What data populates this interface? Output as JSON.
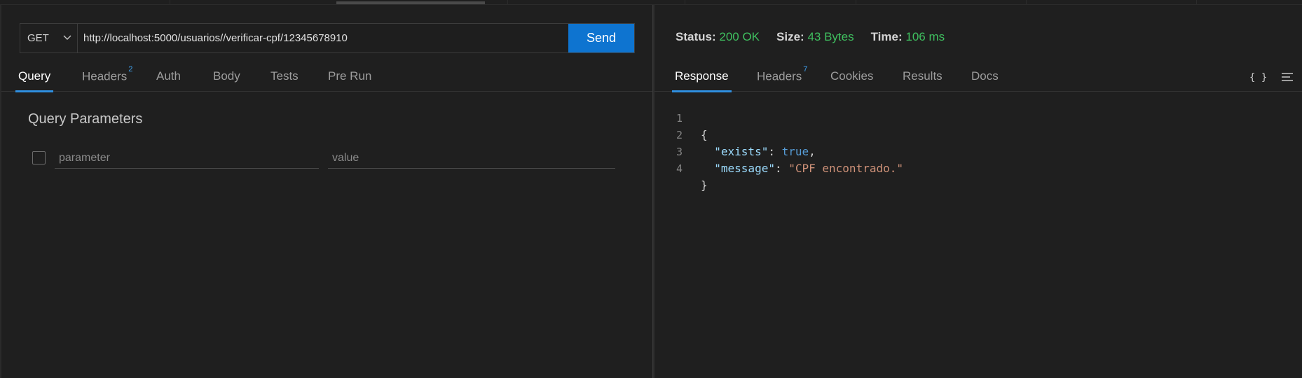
{
  "request": {
    "method": "GET",
    "url": "http://localhost:5000/usuarios//verificar-cpf/12345678910",
    "send_label": "Send",
    "tabs": [
      {
        "label": "Query",
        "badge": ""
      },
      {
        "label": "Headers",
        "badge": "2"
      },
      {
        "label": "Auth",
        "badge": ""
      },
      {
        "label": "Body",
        "badge": ""
      },
      {
        "label": "Tests",
        "badge": ""
      },
      {
        "label": "Pre Run",
        "badge": ""
      }
    ],
    "active_tab": "Query",
    "query_title": "Query Parameters",
    "param_placeholder": "parameter",
    "value_placeholder": "value"
  },
  "response": {
    "status_label": "Status:",
    "status_value": "200 OK",
    "size_label": "Size:",
    "size_value": "43 Bytes",
    "time_label": "Time:",
    "time_value": "106 ms",
    "tabs": [
      {
        "label": "Response",
        "badge": ""
      },
      {
        "label": "Headers",
        "badge": "7"
      },
      {
        "label": "Cookies",
        "badge": ""
      },
      {
        "label": "Results",
        "badge": ""
      },
      {
        "label": "Docs",
        "badge": ""
      }
    ],
    "active_tab": "Response",
    "format_icon_label": "{ }",
    "body_lines": [
      {
        "num": "1",
        "text": "{"
      },
      {
        "num": "2",
        "key": "\"exists\"",
        "sep": ": ",
        "value": "true",
        "trail": ","
      },
      {
        "num": "3",
        "key": "\"message\"",
        "sep": ": ",
        "value": "\"CPF encontrado.\"",
        "trail": ""
      },
      {
        "num": "4",
        "text": "}"
      }
    ]
  },
  "colors": {
    "background": "#1f1f1f",
    "accent": "#0e74d0",
    "status_ok": "#3fbf5f",
    "json_key": "#9cdcfe",
    "json_bool": "#569cd6",
    "json_string": "#ce9178"
  },
  "icons": {
    "method_dropdown": "chevron-down-icon",
    "format": "braces-icon",
    "menu": "menu-icon"
  }
}
